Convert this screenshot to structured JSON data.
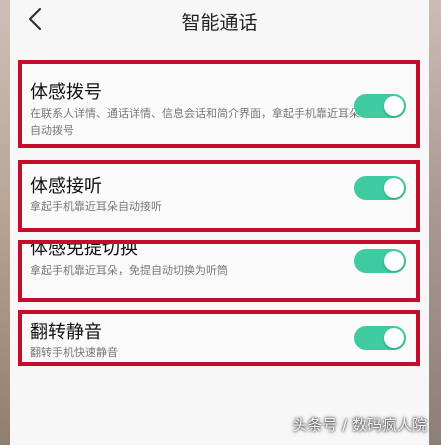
{
  "header": {
    "title": "智能通话",
    "back_icon": "chevron-left-icon"
  },
  "settings": [
    {
      "title": "体感拨号",
      "description": "在联系人详情、通话详情、信息会话和简介界面，拿起手机靠近耳朵自动拨号",
      "enabled": true
    },
    {
      "title": "体感接听",
      "description": "拿起手机靠近耳朵自动接听",
      "enabled": true
    },
    {
      "title": "体感免提切换",
      "description": "拿起手机靠近耳朵，免提自动切换为听筒",
      "enabled": true
    },
    {
      "title": "翻转静音",
      "description": "翻转手机快速静音",
      "enabled": true
    }
  ],
  "watermark": "头条号 / 数码疯人院",
  "colors": {
    "toggle_on": "#3ecb9f",
    "highlight_border": "#c40d2a"
  }
}
